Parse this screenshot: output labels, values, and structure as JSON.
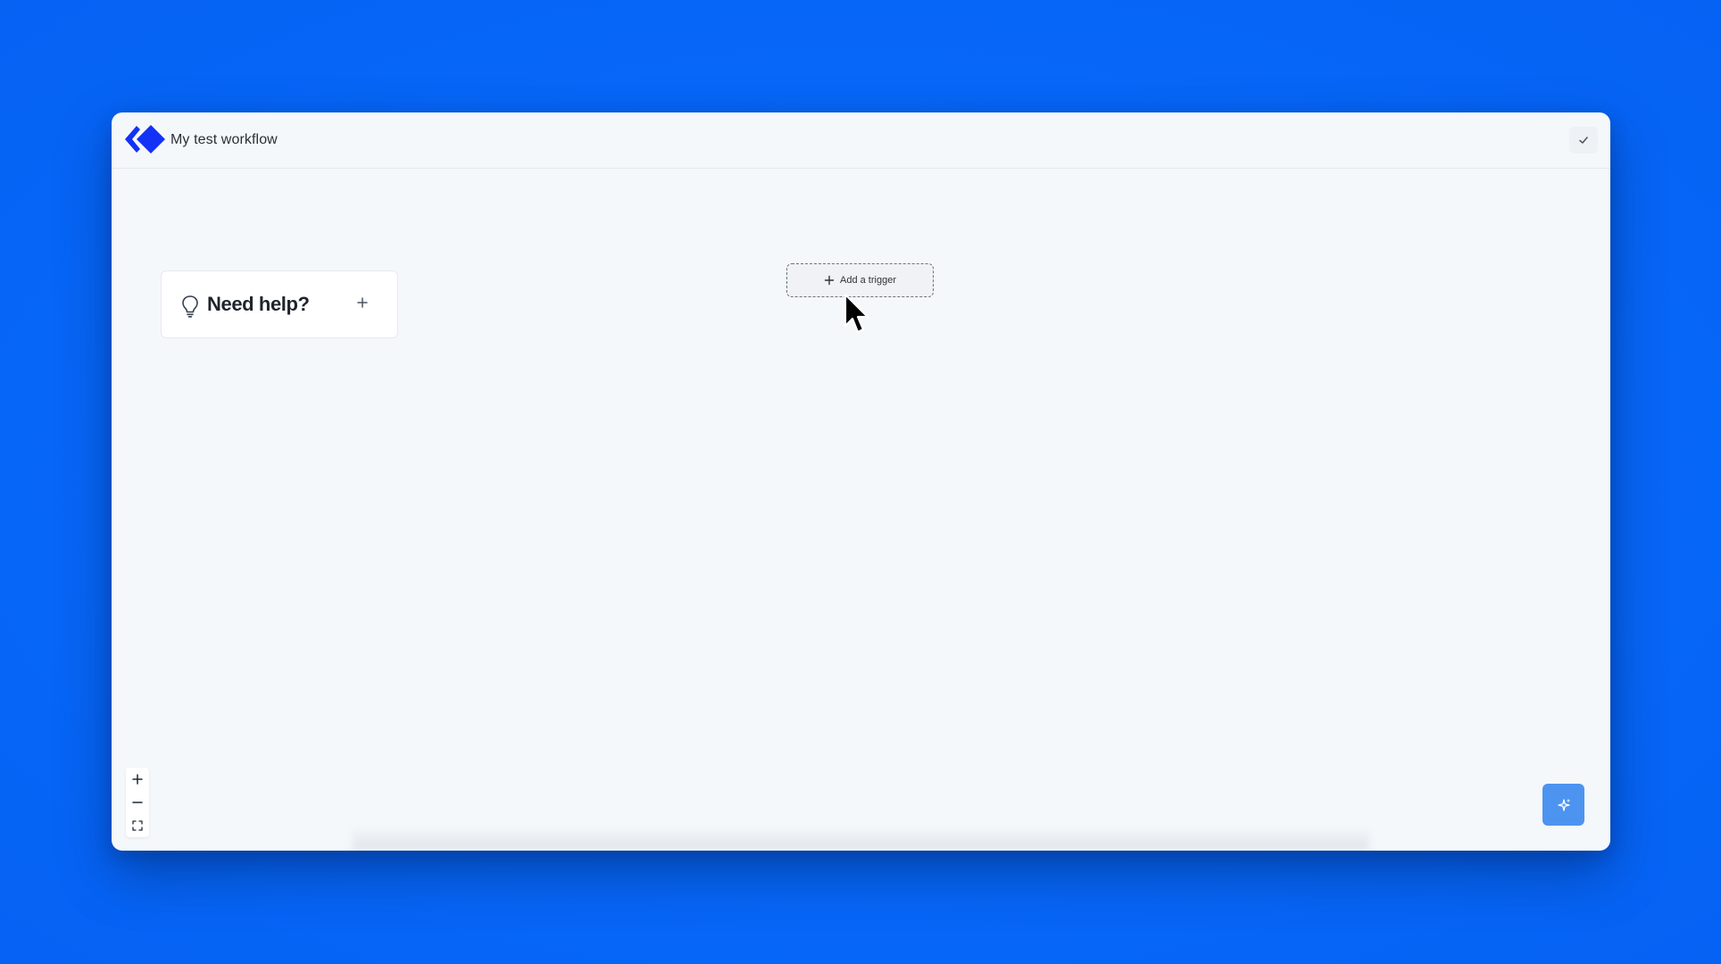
{
  "window": {
    "title": "My test workflow"
  },
  "help_card": {
    "title": "Need help?"
  },
  "canvas": {
    "trigger_label": "Add a trigger"
  },
  "icons": {
    "logo": "app-logo",
    "save": "check-icon",
    "help": "lightbulb-icon",
    "expand": "plus-icon",
    "zoom_in": "plus-icon",
    "zoom_out": "minus-icon",
    "fit_view": "fit-view-icon",
    "ai": "sparkle-icon"
  },
  "colors": {
    "background": "#0769fb",
    "brand": "#1432f5",
    "ai_button": "#4d94f0",
    "canvas": "#f5f8fb"
  }
}
